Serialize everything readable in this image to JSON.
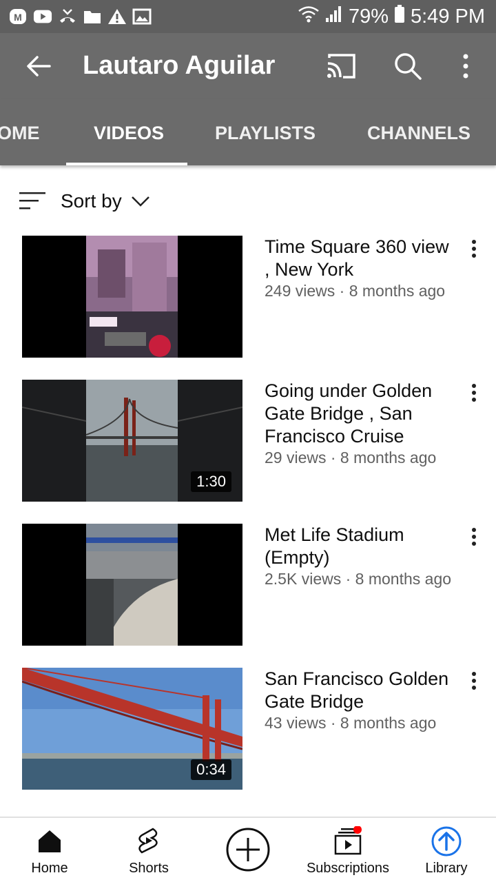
{
  "status_bar": {
    "battery": "79%",
    "time": "5:49 PM"
  },
  "app_bar": {
    "title": "Lautaro Aguilar"
  },
  "tabs": [
    {
      "label": "OME"
    },
    {
      "label": "VIDEOS"
    },
    {
      "label": "PLAYLISTS"
    },
    {
      "label": "CHANNELS"
    }
  ],
  "sort": {
    "label": "Sort by"
  },
  "videos": [
    {
      "title": "Time Square 360 view , New York",
      "meta": "249 views · 8 months ago",
      "duration": ""
    },
    {
      "title": "Going under Golden Gate Bridge , San Francisco Cruise",
      "meta": "29 views · 8 months ago",
      "duration": "1:30"
    },
    {
      "title": "Met Life Stadium (Empty)",
      "meta": "2.5K views · 8 months ago",
      "duration": ""
    },
    {
      "title": "San Francisco Golden Gate Bridge",
      "meta": "43 views · 8 months ago",
      "duration": "0:34"
    }
  ],
  "bottom_nav": [
    {
      "label": "Home"
    },
    {
      "label": "Shorts"
    },
    {
      "label": "Subscriptions"
    },
    {
      "label": "Library"
    }
  ],
  "colors": {
    "app_bar": "#6b6b6b",
    "status_bar": "#5f5f5f",
    "library_accent": "#1a73e8",
    "notification_dot": "#ff0000"
  }
}
